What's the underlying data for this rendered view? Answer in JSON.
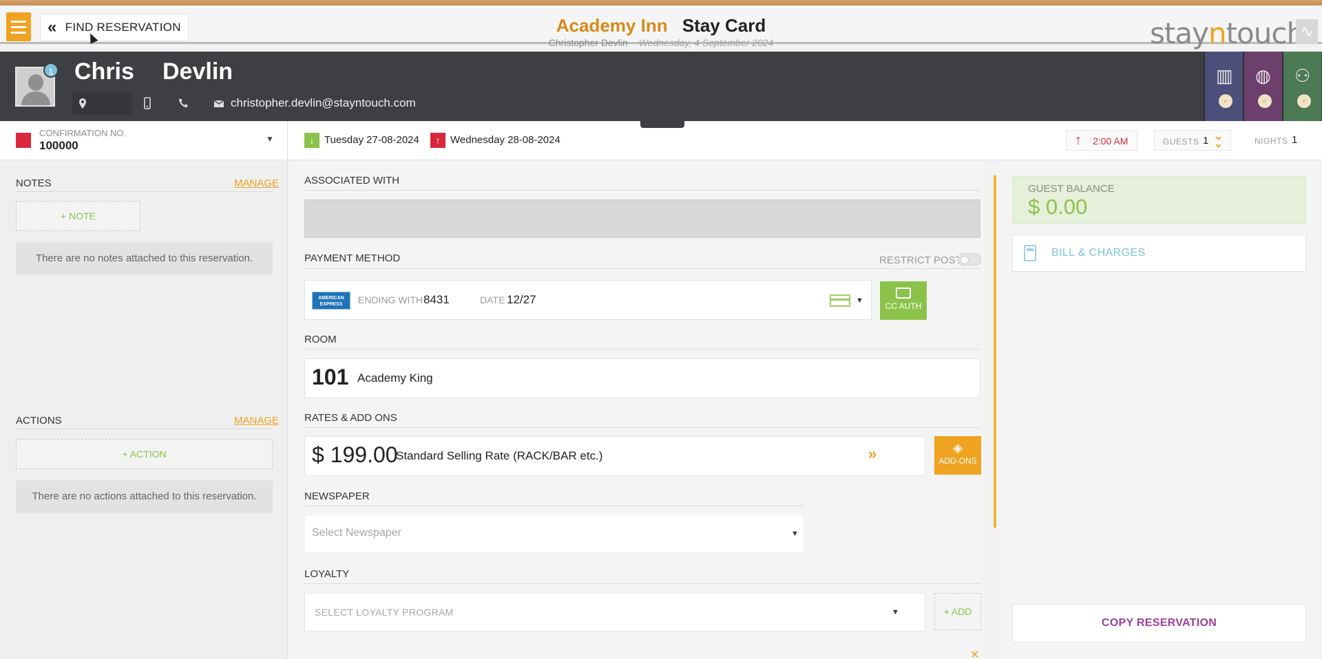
{
  "app": {
    "hotel_name": "Academy Inn",
    "page_title": "Stay Card",
    "user_name": "Christopher Devlin",
    "business_date": "Wednesday, 4 September 2024",
    "brand_prefix": "stay",
    "brand_mid": "n",
    "brand_suffix": "touch",
    "find_reservation_label": "FIND RESERVATION"
  },
  "guest": {
    "first_name": "Chris",
    "last_name": "Devlin",
    "badge_count": "1",
    "email": "christopher.devlin@stayntouch.com"
  },
  "reservation": {
    "confirmation_label": "CONFIRMATION NO.",
    "confirmation_number": "100000",
    "arrival": "Tuesday 27-08-2024",
    "departure": "Wednesday 28-08-2024",
    "departure_time": "2:00 AM",
    "guests_label": "GUESTS",
    "guests_count": "1",
    "nights_label": "NIGHTS",
    "nights_count": "1"
  },
  "notes": {
    "title": "NOTES",
    "manage": "MANAGE",
    "add_label": "+ NOTE",
    "empty_text": "There are no notes attached to this reservation."
  },
  "actions": {
    "title": "ACTIONS",
    "manage": "MANAGE",
    "add_label": "+ ACTION",
    "empty_text": "There are no actions attached to this reservation."
  },
  "main": {
    "associated_with_label": "ASSOCIATED WITH",
    "payment_method_label": "PAYMENT METHOD",
    "restrict_post_label": "RESTRICT POST",
    "card_brand": "AMERICAN EXPRESS",
    "ending_with_label": "ENDING WITH",
    "card_last4": "8431",
    "date_label": "DATE",
    "card_expiry": "12/27",
    "cc_auth_label": "CC AUTH",
    "room_label": "ROOM",
    "room_number": "101",
    "room_type": "Academy King",
    "rates_label": "RATES & ADD ONS",
    "rate_amount": "$ 199.00",
    "rate_name": "Standard Selling Rate (RACK/BAR etc.)",
    "addons_label": "ADD-ONS",
    "newspaper_label": "NEWSPAPER",
    "newspaper_placeholder": "Select Newspaper",
    "loyalty_label": "LOYALTY",
    "loyalty_placeholder": "SELECT LOYALTY PROGRAM",
    "loyalty_add_label": "+ ADD"
  },
  "side": {
    "balance_label": "GUEST BALANCE",
    "balance_value": "$ 0.00",
    "bill_label": "BILL & CHARGES",
    "copy_label": "COPY RESERVATION"
  },
  "colors": {
    "accent_orange": "#f0a320",
    "header_dark": "#3d3f42",
    "success_green": "#8bc34a",
    "alert_red": "#d9283b",
    "link_blue": "#7ec3dc",
    "copy_purple": "#9c3e9c"
  },
  "icons": {
    "menu": "hamburger-icon",
    "back": "double-chevron-left-icon",
    "location": "map-pin-icon",
    "mobile": "mobile-phone-icon",
    "phone": "phone-icon",
    "email": "envelope-icon",
    "arrival": "arrow-down-icon",
    "departure": "arrow-up-icon",
    "addons": "layers-icon",
    "bill": "calculator-icon"
  }
}
